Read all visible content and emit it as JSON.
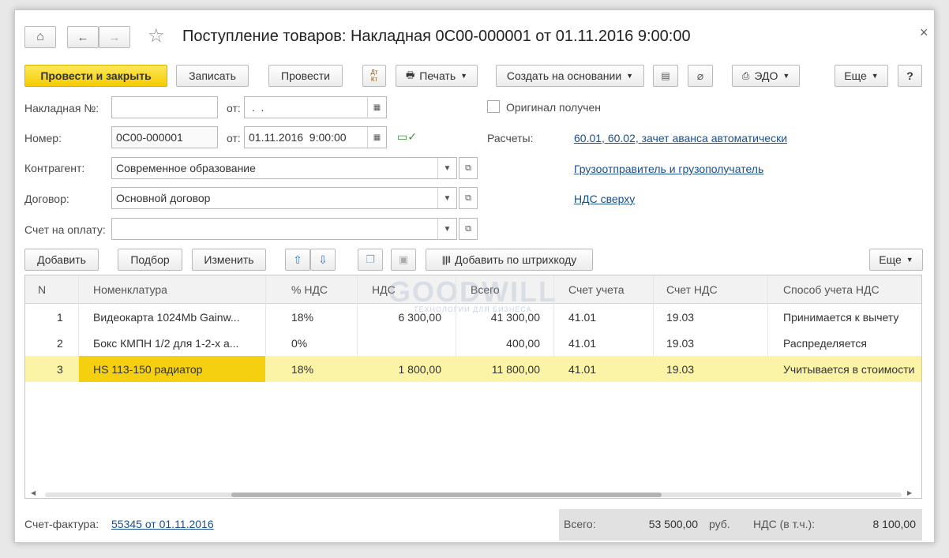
{
  "window": {
    "title": "Поступление товаров: Накладная 0С00-000001 от 01.11.2016 9:00:00",
    "close": "×"
  },
  "nav": {
    "home": "⌂",
    "back": "←",
    "forward": "→",
    "star": "☆"
  },
  "toolbar": {
    "post_close": "Провести и закрыть",
    "save": "Записать",
    "post": "Провести",
    "dtkt": "Дт Кт",
    "print": "Печать",
    "create_based": "Создать на основании",
    "edo": "ЭДО",
    "more": "Еще",
    "help": "?"
  },
  "form": {
    "invoice_no_label": "Накладная №:",
    "invoice_no_value": "",
    "from_label": "от:",
    "invoice_date_value": " .  .",
    "number_label": "Номер:",
    "number_value": "0С00-000001",
    "number_date_value": "01.11.2016  9:00:00",
    "contractor_label": "Контрагент:",
    "contractor_value": "Современное образование",
    "contract_label": "Договор:",
    "contract_value": "Основной договор",
    "pay_account_label": "Счет на оплату:",
    "pay_account_value": "",
    "original_received": "Оригинал получен",
    "settlements_label": "Расчеты:",
    "settlements_link": "60.01, 60.02, зачет аванса автоматически",
    "shipper_link": "Грузоотправитель и грузополучатель",
    "vat_link": "НДС сверху"
  },
  "table_toolbar": {
    "add": "Добавить",
    "pick": "Подбор",
    "edit": "Изменить",
    "barcode": "Добавить по штрихкоду",
    "more": "Еще"
  },
  "watermark": {
    "brand": "GOODWILL",
    "tagline": "ТЕХНОЛОГИИ ДЛЯ БИЗНЕСА"
  },
  "table": {
    "columns": [
      "N",
      "Номенклатура",
      "% НДС",
      "НДС",
      "Всего",
      "Счет учета",
      "Счет НДС",
      "Способ учета НДС"
    ],
    "rows": [
      {
        "n": "1",
        "name": "Видеокарта 1024Mb Gainw...",
        "vat_rate": "18%",
        "vat": "6 300,00",
        "total": "41 300,00",
        "account": "41.01",
        "vat_account": "19.03",
        "method": "Принимается к вычету"
      },
      {
        "n": "2",
        "name": "Бокс КМПН 1/2 для 1-2-х а...",
        "vat_rate": "0%",
        "vat": "",
        "total": "400,00",
        "account": "41.01",
        "vat_account": "19.03",
        "method": "Распределяется"
      },
      {
        "n": "3",
        "name": "HS 113-150 радиатор",
        "vat_rate": "18%",
        "vat": "1 800,00",
        "total": "11 800,00",
        "account": "41.01",
        "vat_account": "19.03",
        "method": "Учитывается в стоимости"
      }
    ],
    "selected_row": 2
  },
  "footer": {
    "invoice_label": "Счет-фактура:",
    "invoice_link": "55345 от 01.11.2016",
    "total_label": "Всего:",
    "total_value": "53 500,00",
    "currency": "руб.",
    "vat_label": "НДС (в т.ч.):",
    "vat_value": "8 100,00"
  },
  "colors": {
    "primary_button": "#f5cc00",
    "selected_row": "#fbf3a6",
    "selected_cell": "#f5d010",
    "link": "#1a4f8a"
  }
}
